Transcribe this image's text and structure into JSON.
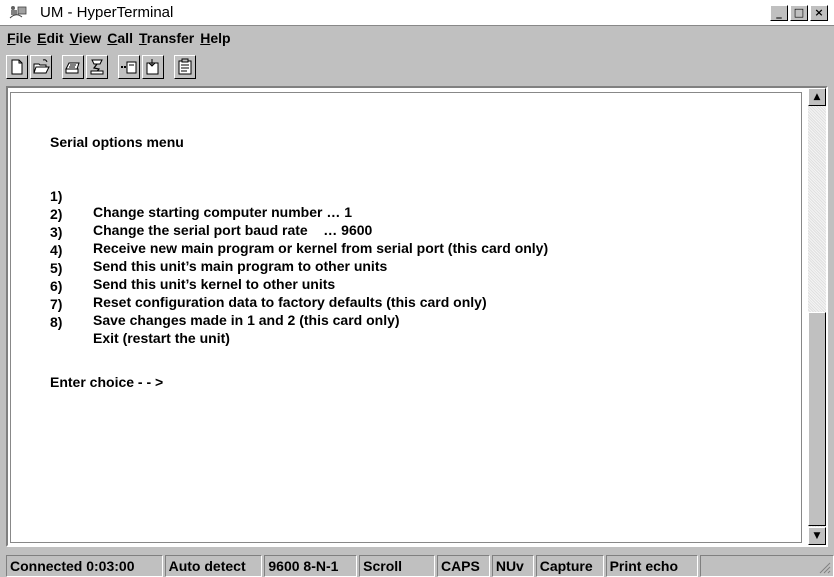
{
  "window": {
    "title": "UM - HyperTerminal",
    "controls": [
      "_",
      "□",
      "×"
    ]
  },
  "menu": [
    {
      "label": "File"
    },
    {
      "label": "Edit"
    },
    {
      "label": "View"
    },
    {
      "label": "Call"
    },
    {
      "label": "Transfer"
    },
    {
      "label": "Help"
    }
  ],
  "toolbar": {
    "icons": [
      "new-connection-icon",
      "open-icon",
      "connect-icon",
      "disconnect-icon",
      "send-icon",
      "receive-icon",
      "properties-icon"
    ]
  },
  "terminal": {
    "heading": "Serial options menu",
    "options": [
      {
        "num": "1)",
        "text": "Change starting computer number … 1"
      },
      {
        "num": "2)",
        "text": "Change the serial port baud rate    … 9600"
      },
      {
        "num": "3)",
        "text": "Receive new main program or kernel from serial port (this card only)"
      },
      {
        "num": "4)",
        "text": "Send this unit’s main program to other units"
      },
      {
        "num": "5)",
        "text": "Send this unit’s kernel to other units"
      },
      {
        "num": "6)",
        "text": "Reset configuration data to factory defaults (this card only)"
      },
      {
        "num": "7)",
        "text": "Save changes made in 1 and 2 (this card only)"
      },
      {
        "num": "8)",
        "text": "Exit (restart the unit)"
      }
    ],
    "prompt": "Enter choice - - >"
  },
  "status": {
    "connected": "Connected 0:03:00",
    "detect": "Auto detect",
    "settings": "9600 8-N-1",
    "scroll": "Scroll",
    "caps": "CAPS",
    "num": "NUv",
    "capture": "Capture",
    "print_echo": "Print echo"
  }
}
